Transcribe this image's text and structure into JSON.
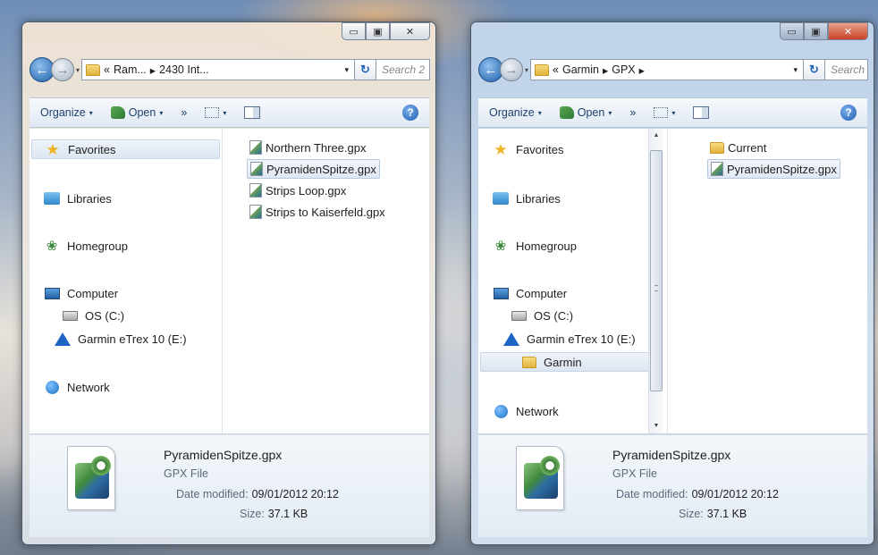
{
  "windows": [
    {
      "id": "left",
      "caption": {
        "minimize": "▭",
        "maximize": "▣",
        "close": "✕"
      },
      "address": {
        "crumbs": [
          "«",
          "Ram...",
          "▸",
          "2430 Int..."
        ],
        "search_placeholder": "Search 2"
      },
      "toolbar": {
        "organize": "Organize",
        "open": "Open",
        "more": "»"
      },
      "nav": {
        "favorites": "Favorites",
        "libraries": "Libraries",
        "homegroup": "Homegroup",
        "computer": "Computer",
        "os": "OS (C:)",
        "garmin_drive": "Garmin eTrex 10 (E:)",
        "network": "Network"
      },
      "files": [
        "Northern Three.gpx",
        "PyramidenSpitze.gpx",
        "Strips Loop.gpx",
        "Strips to Kaiserfeld.gpx"
      ],
      "details": {
        "name": "PyramidenSpitze.gpx",
        "type": "GPX File",
        "date_label": "Date modified:",
        "date_value": "09/01/2012 20:12",
        "size_label": "Size:",
        "size_value": "37.1 KB"
      }
    },
    {
      "id": "right",
      "caption": {
        "minimize": "▭",
        "maximize": "▣",
        "close": "✕"
      },
      "address": {
        "crumbs": [
          "«",
          "Garmin",
          "▸",
          "GPX",
          "▸"
        ],
        "search_placeholder": "Search"
      },
      "toolbar": {
        "organize": "Organize",
        "open": "Open",
        "more": "»"
      },
      "nav": {
        "favorites": "Favorites",
        "libraries": "Libraries",
        "homegroup": "Homegroup",
        "computer": "Computer",
        "os": "OS (C:)",
        "garmin_drive": "Garmin eTrex 10 (E:)",
        "garmin_folder": "Garmin",
        "network": "Network"
      },
      "files": [
        "Current",
        "PyramidenSpitze.gpx"
      ],
      "details": {
        "name": "PyramidenSpitze.gpx",
        "type": "GPX File",
        "date_label": "Date modified:",
        "date_value": "09/01/2012 20:12",
        "size_label": "Size:",
        "size_value": "37.1 KB"
      }
    }
  ],
  "icons": {
    "back": "←",
    "dropdown": "▾",
    "refresh": "↻",
    "help": "?",
    "star": "★",
    "home": "❀",
    "scroll_up": "▲",
    "scroll_down": "▼"
  }
}
